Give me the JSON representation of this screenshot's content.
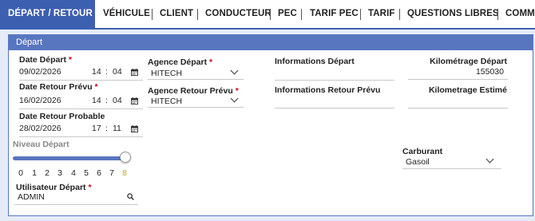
{
  "tabs": [
    {
      "label": "DÉPART / RETOUR"
    },
    {
      "label": "VÉHICULE"
    },
    {
      "label": "CLIENT"
    },
    {
      "label": "CONDUCTEUR"
    },
    {
      "label": "PEC"
    },
    {
      "label": "TARIF PEC"
    },
    {
      "label": "TARIF"
    },
    {
      "label": "QUESTIONS LIBRES"
    },
    {
      "label": "COMMEN"
    }
  ],
  "panel": {
    "title": "Départ",
    "date_depart": {
      "label": "Date Départ",
      "date": "09/02/2026",
      "hour": "14",
      "minute": "04"
    },
    "date_retour_prevu": {
      "label": "Date Retour Prévu",
      "date": "16/02/2026",
      "hour": "14",
      "minute": "04"
    },
    "date_retour_probable": {
      "label": "Date Retour Probable",
      "date": "28/02/2026",
      "hour": "17",
      "minute": "11"
    },
    "agence_depart": {
      "label": "Agence Départ",
      "value": "HITECH"
    },
    "agence_retour_prevu": {
      "label": "Agence Retour Prévu",
      "value": "HITECH"
    },
    "informations_depart": {
      "label": "Informations Départ",
      "value": ""
    },
    "informations_retour_prevu": {
      "label": "Informations Retour Prévu",
      "value": ""
    },
    "km_depart": {
      "label": "Kilométrage Départ",
      "value": "155030"
    },
    "km_estime": {
      "label": "Kilometrage Estimé",
      "value": ""
    },
    "niveau_depart": {
      "label": "Niveau Départ",
      "ticks": [
        "0",
        "1",
        "2",
        "3",
        "4",
        "5",
        "6",
        "7",
        "8"
      ],
      "selected": 8
    },
    "carburant": {
      "label": "Carburant",
      "value": "Gasoil"
    },
    "utilisateur_depart": {
      "label": "Utilisateur Départ",
      "value": "ADMIN"
    }
  },
  "colors": {
    "accent": "#3d5fb0",
    "header": "#5876c0",
    "required": "#d0021b",
    "selected_tick": "#c9a227"
  }
}
